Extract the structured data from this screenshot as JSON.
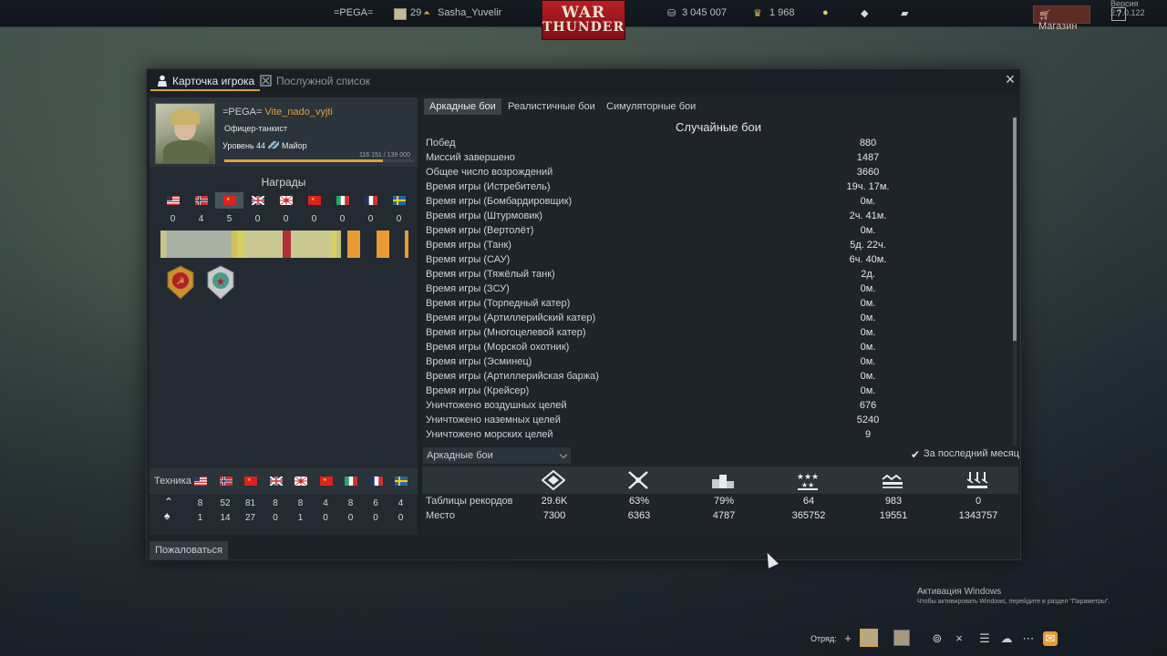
{
  "topbar": {
    "squad_tag": "=PEGA=",
    "friend_level": "29",
    "friend_name": "Sasha_Yuvelir",
    "logo_line1": "WAR",
    "logo_line2": "THUNDER",
    "silver_lions": "3 045 007",
    "golden_eagles": "1 968",
    "shop_label": "Магазин",
    "help_label": "?",
    "version": "Версия 2.7.0.122"
  },
  "dialog": {
    "tabs": [
      {
        "label": "Карточка игрока",
        "icon": "player-icon"
      },
      {
        "label": "Послужной список",
        "icon": "service-record-icon"
      }
    ],
    "close_label": "×"
  },
  "profile": {
    "clan_tag": "=PEGA=",
    "nickname": "Vite_nado_vyjti",
    "title": "Офицер-танкист",
    "level_label": "Уровень 44",
    "rank_label": "Майор",
    "exp_text": "116 151 / 139 000",
    "exp_fraction": 0.836
  },
  "awards": {
    "title": "Награды",
    "nations": [
      {
        "nation": "usa",
        "count": "0"
      },
      {
        "nation": "norway",
        "count": "4"
      },
      {
        "nation": "china",
        "count": "5"
      },
      {
        "nation": "britain",
        "count": "0"
      },
      {
        "nation": "japan",
        "count": "0"
      },
      {
        "nation": "china-2",
        "count": "0"
      },
      {
        "nation": "italy",
        "count": "0"
      },
      {
        "nation": "france",
        "count": "0"
      },
      {
        "nation": "sweden",
        "count": "0"
      }
    ],
    "selected_index": 2,
    "medals": [
      "soviet-guards-medal-icon",
      "excellent-tanker-badge-icon"
    ]
  },
  "vehicles": {
    "label": "Техника",
    "nations": [
      "usa",
      "norway",
      "china",
      "britain",
      "japan",
      "china-2",
      "italy",
      "france",
      "sweden"
    ],
    "researched": [
      "8",
      "52",
      "81",
      "8",
      "8",
      "4",
      "8",
      "6",
      "4"
    ],
    "elite": [
      "1",
      "14",
      "27",
      "0",
      "1",
      "0",
      "0",
      "0",
      "0"
    ],
    "row1_icon": "up-chevron-icon",
    "row2_icon": "spade-icon"
  },
  "stats": {
    "mode_tabs": [
      "Аркадные бои",
      "Реалистичные бои",
      "Симуляторные бои"
    ],
    "active_mode": 0,
    "section_title": "Случайные бои",
    "rows": [
      {
        "k": "Побед",
        "v": "880"
      },
      {
        "k": "Миссий завершено",
        "v": "1487"
      },
      {
        "k": "Общее число возрождений",
        "v": "3660"
      },
      {
        "k": "Время игры (Истребитель)",
        "v": "19ч. 17м."
      },
      {
        "k": "Время игры (Бомбардировщик)",
        "v": "0м."
      },
      {
        "k": "Время игры (Штурмовик)",
        "v": "2ч. 41м."
      },
      {
        "k": "Время игры (Вертолёт)",
        "v": "0м."
      },
      {
        "k": "Время игры (Танк)",
        "v": "5д. 22ч."
      },
      {
        "k": "Время игры (САУ)",
        "v": "6ч. 40м."
      },
      {
        "k": "Время игры (Тяжёлый танк)",
        "v": "2д."
      },
      {
        "k": "Время игры (ЗСУ)",
        "v": "0м."
      },
      {
        "k": "Время игры (Торпедный катер)",
        "v": "0м."
      },
      {
        "k": "Время игры (Артиллерийский катер)",
        "v": "0м."
      },
      {
        "k": "Время игры (Многоцелевой катер)",
        "v": "0м."
      },
      {
        "k": "Время игры (Морской охотник)",
        "v": "0м."
      },
      {
        "k": "Время игры (Эсминец)",
        "v": "0м."
      },
      {
        "k": "Время игры (Артиллерийская баржа)",
        "v": "0м."
      },
      {
        "k": "Время игры (Крейсер)",
        "v": "0м."
      },
      {
        "k": "Уничтожено воздушных целей",
        "v": "676"
      },
      {
        "k": "Уничтожено наземных целей",
        "v": "5240"
      },
      {
        "k": "Уничтожено морских целей",
        "v": "9"
      }
    ],
    "records_mode_dropdown": "Аркадные бои",
    "last_month_label": "За последний месяц",
    "last_month_checked": true
  },
  "records": {
    "icons": [
      "efficiency-icon",
      "kills-crossed-swords-icon",
      "podium-icon",
      "air-kills-stars-icon",
      "ground-kills-icon",
      "naval-kills-icon"
    ],
    "row_labels": [
      "Таблицы рекордов",
      "Место"
    ],
    "leaderboard": [
      "29.6K",
      "63%",
      "79%",
      "64",
      "983",
      "0"
    ],
    "place": [
      "7300",
      "6363",
      "4787",
      "365752",
      "19551",
      "1343757"
    ]
  },
  "report_label": "Пожаловаться",
  "windows": {
    "title": "Активация Windows",
    "subtitle": "Чтобы активировать Windows, перейдите в раздел \"Параметры\"."
  },
  "bottombar": {
    "squad_label": "Отряд:",
    "icons": [
      "add-icon",
      "list-icon",
      "contacts-icon",
      "chat-icon",
      "mail-icon"
    ]
  }
}
